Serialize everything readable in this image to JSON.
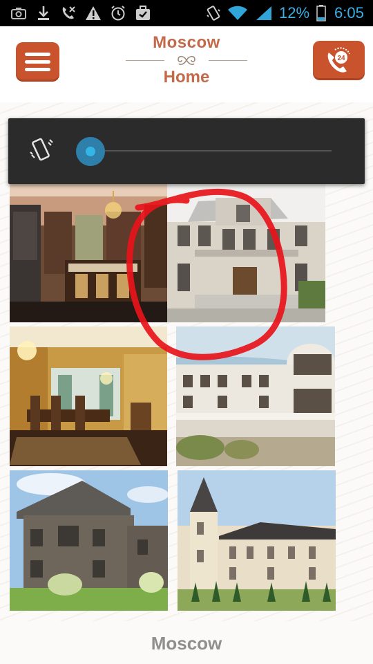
{
  "status_bar": {
    "battery_percent": "12%",
    "time": "6:05",
    "left_icons": [
      "camera-icon",
      "download-icon",
      "missed-call-icon",
      "warning-icon",
      "alarm-icon",
      "briefcase-check-icon"
    ],
    "right_icons": [
      "vibrate-icon",
      "wifi-icon",
      "signal-icon",
      "battery-icon"
    ]
  },
  "header": {
    "logo_line1": "Moscow",
    "logo_line2": "Home",
    "menu_icon": "hamburger-icon",
    "call_icon": "phone-24-icon",
    "brand_color": "#c8532c"
  },
  "volume_panel": {
    "mode_icon": "vibrate-icon",
    "level": 0
  },
  "gallery": [
    {
      "name": "classic-kitchen-photo"
    },
    {
      "name": "white-mansion-photo"
    },
    {
      "name": "golden-dining-room-photo"
    },
    {
      "name": "modern-villa-photo"
    },
    {
      "name": "brown-brick-house-photo"
    },
    {
      "name": "turret-chateau-photo"
    }
  ],
  "annotation": {
    "shape": "hand-drawn circle",
    "color": "#e8141b"
  },
  "footer": {
    "logo_line1": "Moscow"
  }
}
